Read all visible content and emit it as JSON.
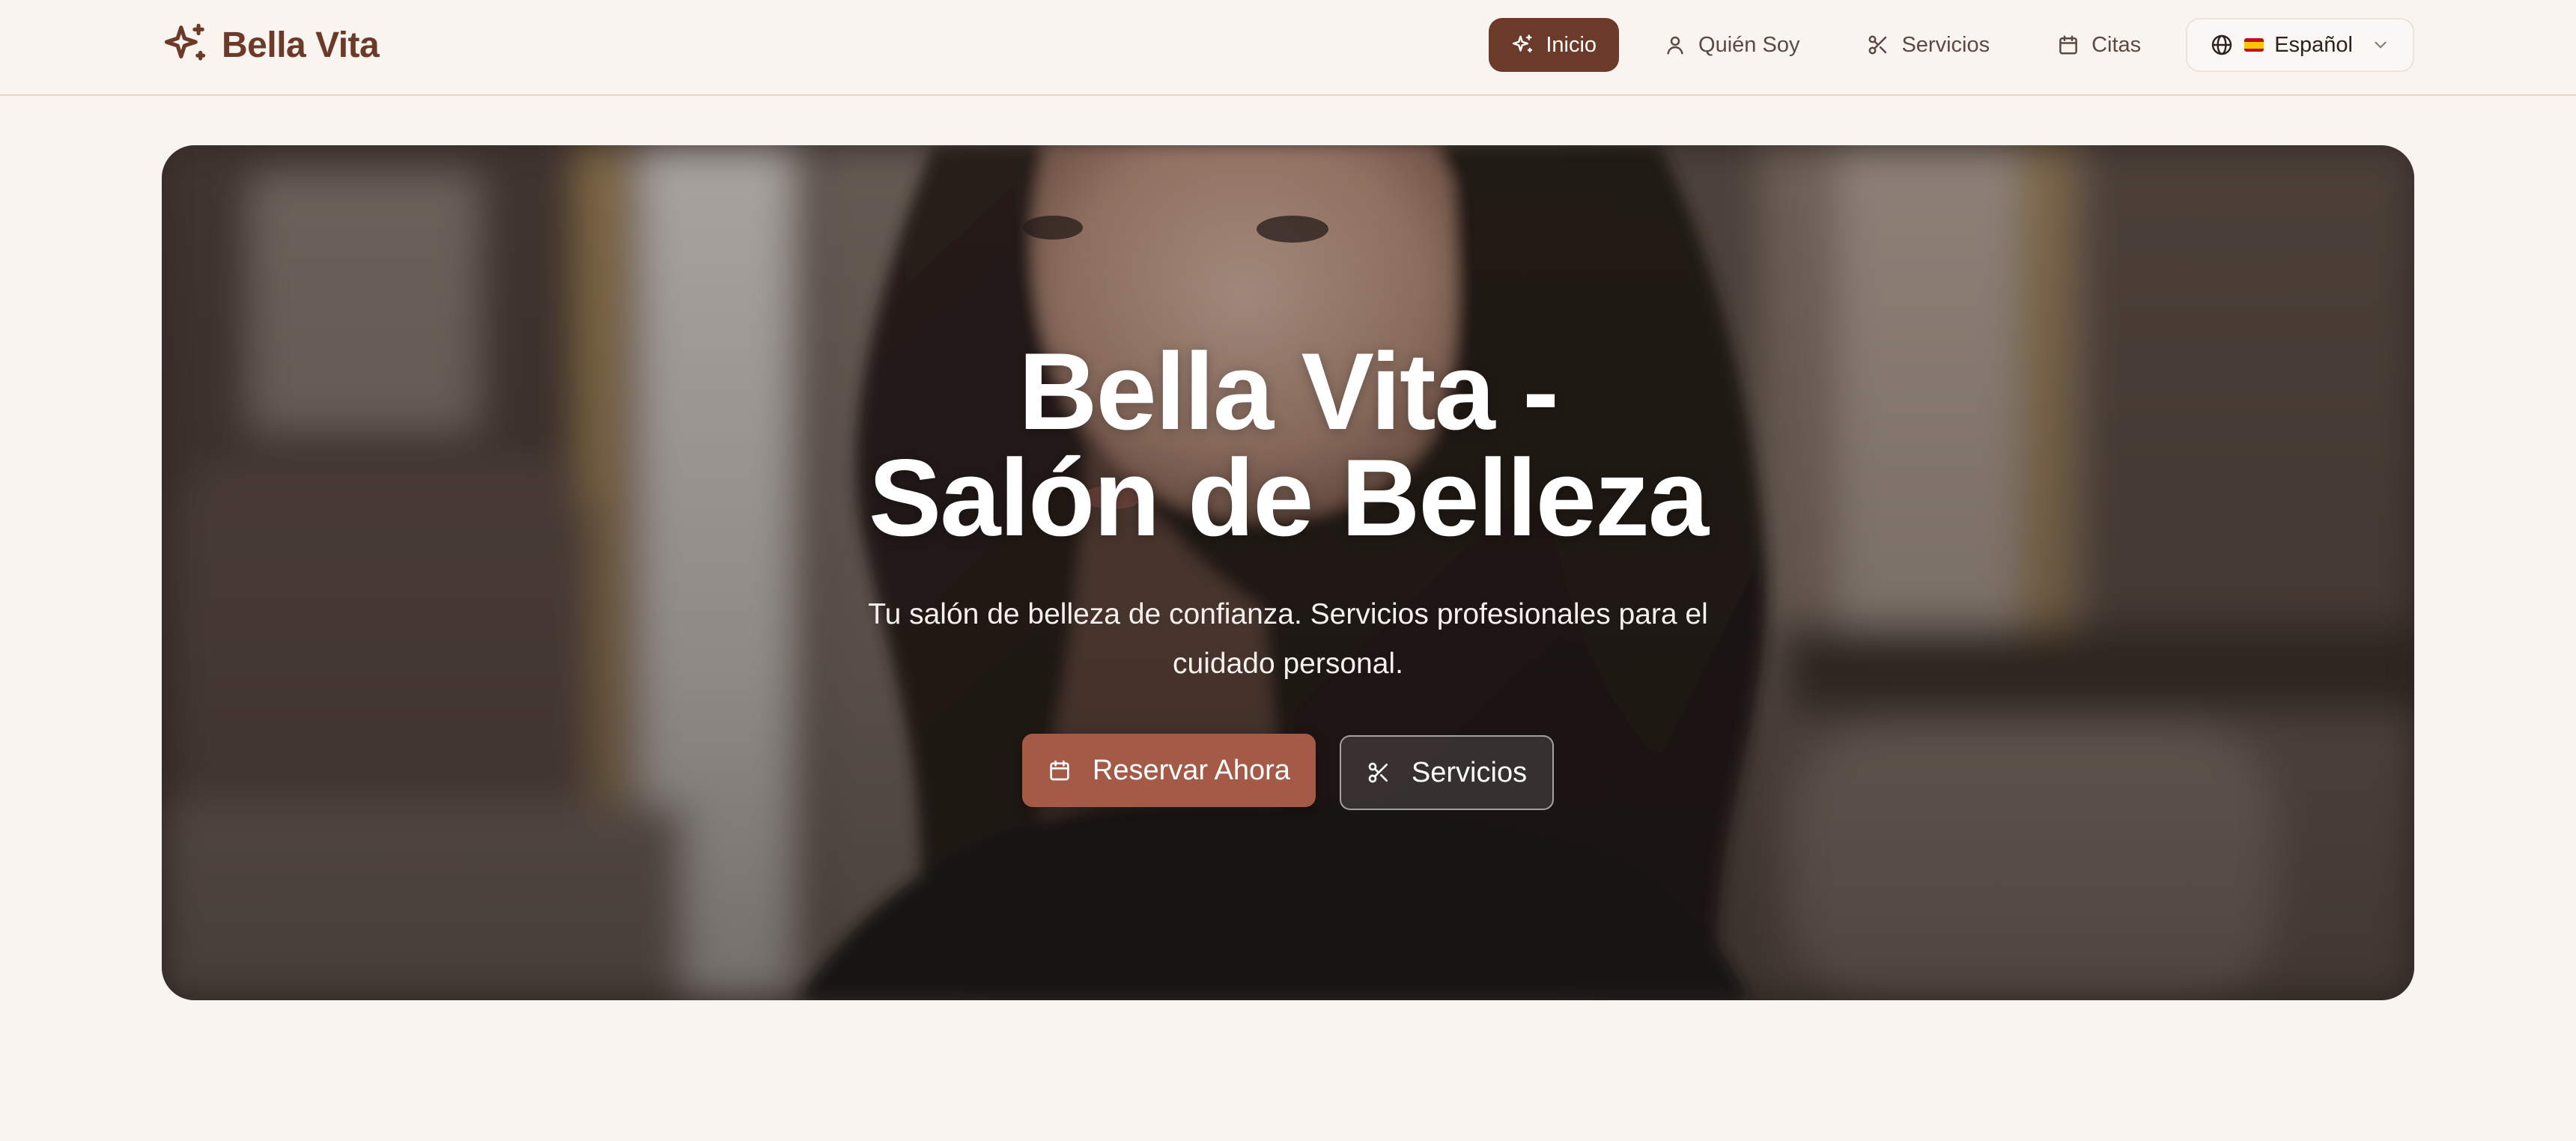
{
  "brand": {
    "name": "Bella Vita",
    "icon": "sparkles-icon",
    "color": "#6b3a29"
  },
  "nav": {
    "items": [
      {
        "label": "Inicio",
        "icon": "sparkles-icon",
        "active": true
      },
      {
        "label": "Quién Soy",
        "icon": "user-icon"
      },
      {
        "label": "Servicios",
        "icon": "scissors-icon"
      },
      {
        "label": "Citas",
        "icon": "calendar-icon"
      }
    ],
    "language": {
      "label": "Español",
      "icon": "globe-icon",
      "flag": "es-flag"
    }
  },
  "hero": {
    "title_line1": "Bella Vita -",
    "title_line2": "Salón de Belleza",
    "subtitle": "Tu salón de belleza de confianza. Servicios profesionales para el cuidado personal.",
    "primary_button": {
      "label": "Reservar Ahora",
      "icon": "calendar-icon",
      "color": "#a45a47"
    },
    "secondary_button": {
      "label": "Servicios",
      "icon": "scissors-icon"
    }
  }
}
